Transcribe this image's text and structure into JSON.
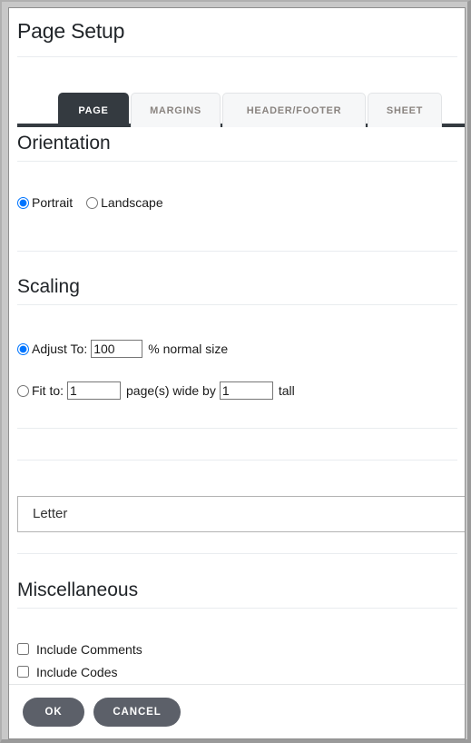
{
  "dialog": {
    "title": "Page Setup"
  },
  "tabs": [
    {
      "label": "PAGE",
      "active": true,
      "width": 78
    },
    {
      "label": "MARGINS",
      "active": false,
      "width": 99
    },
    {
      "label": "HEADER/FOOTER",
      "active": false,
      "width": 158
    },
    {
      "label": "SHEET",
      "active": false,
      "width": 82
    }
  ],
  "orientation": {
    "heading": "Orientation",
    "options": [
      {
        "label": "Portrait",
        "selected": true
      },
      {
        "label": "Landscape",
        "selected": false
      }
    ]
  },
  "scaling": {
    "heading": "Scaling",
    "adjust": {
      "label": "Adjust To:",
      "selected": true,
      "value": "100",
      "suffix": "% normal size"
    },
    "fit": {
      "label": "Fit to:",
      "selected": false,
      "wide_value": "1",
      "middle": "page(s) wide by",
      "tall_value": "1",
      "suffix": "tall"
    }
  },
  "paper": {
    "selected": "Letter"
  },
  "miscellaneous": {
    "heading": "Miscellaneous",
    "checkboxes": [
      {
        "label": "Include Comments",
        "checked": false
      },
      {
        "label": "Include Codes",
        "checked": false
      }
    ]
  },
  "footer": {
    "ok_label": "OK",
    "cancel_label": "CANCEL"
  },
  "colors": {
    "active_tab_bg": "#343a40",
    "inactive_tab_bg": "#f6f7f8",
    "button_bg": "#5c6069",
    "text": "#212529",
    "frame": "#c8c8c8"
  }
}
